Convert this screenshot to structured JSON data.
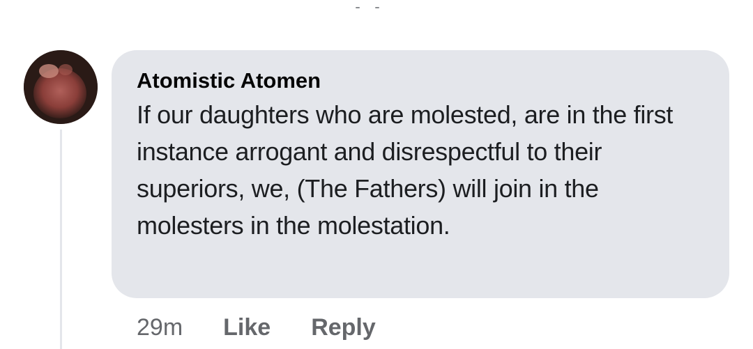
{
  "comment": {
    "author": "Atomistic Atomen",
    "text": "If our daughters who are molested, are in the first instance arrogant and disrespectful to their superiors, we, (The Fathers) will join in the molesters in the molestation.",
    "avatar_icon": "profile-photo"
  },
  "actions": {
    "timestamp": "29m",
    "like_label": "Like",
    "reply_label": "Reply"
  },
  "colors": {
    "bubble": "#e4e6eb",
    "text": "#1c1e21",
    "meta": "#65676b"
  }
}
